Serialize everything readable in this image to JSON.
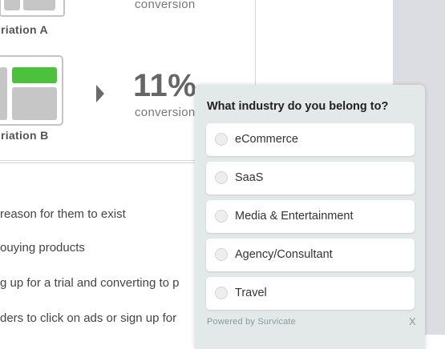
{
  "background_page": {
    "variation_a": {
      "label": "riation A",
      "conversion_label": "conversion"
    },
    "variation_b": {
      "label": "riation B",
      "percent": "11%",
      "conversion_label": "conversion"
    },
    "body_lines": [
      "reason for them to exist",
      "ouying products",
      "g up for a trial and converting to p",
      "ders to click on ads or sign up for"
    ],
    "colors": {
      "thumbnail_gray": "#c6c6c6",
      "highlight_green": "#4cc23c",
      "gutter": "#dcdde3"
    }
  },
  "survey": {
    "question": "What industry do you belong to?",
    "options": [
      "eCommerce",
      "SaaS",
      "Media & Entertainment",
      "Agency/Consultant",
      "Travel"
    ],
    "footer_text": "Powered by Survicate",
    "close_label": "X",
    "colors": {
      "panel_bg": "#e3e8e8",
      "option_bg": "#ffffff"
    }
  }
}
